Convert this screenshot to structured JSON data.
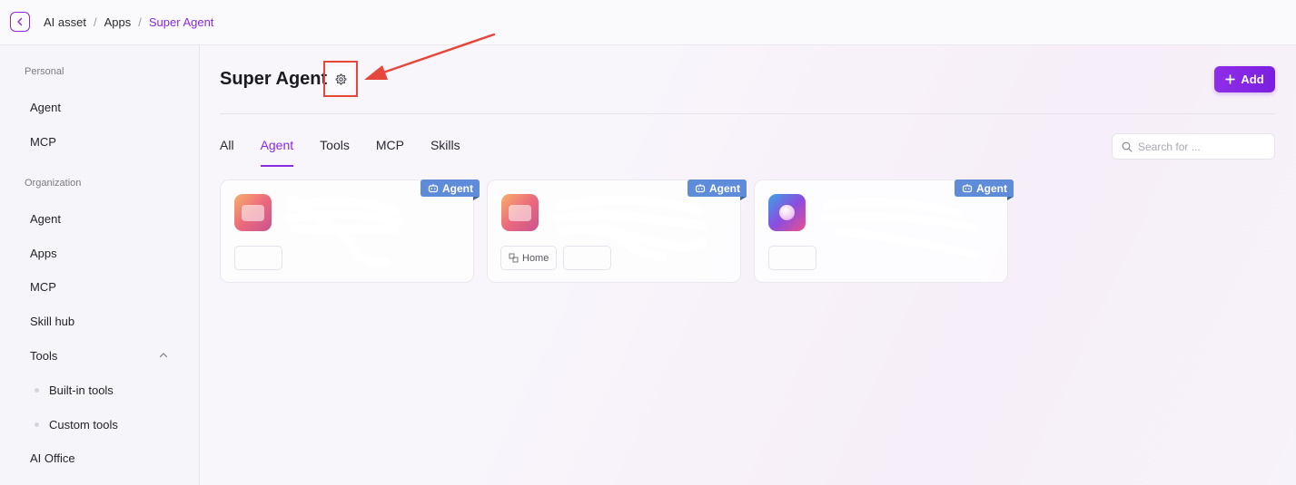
{
  "breadcrumb": [
    "AI asset",
    "Apps",
    "Super Agent"
  ],
  "sidebar": {
    "personal_label": "Personal",
    "personal_items": [
      "Agent",
      "MCP"
    ],
    "org_label": "Organization",
    "org_items": [
      "Agent",
      "Apps",
      "MCP",
      "Skill hub",
      "Tools"
    ],
    "tools_sub": [
      "Built-in tools",
      "Custom tools"
    ],
    "last_item": "AI Office"
  },
  "main": {
    "title": "Super Agent",
    "add_label": "Add",
    "tabs": [
      "All",
      "Agent",
      "Tools",
      "MCP",
      "Skills"
    ],
    "active_tab": "Agent",
    "search_placeholder": "Search for ..."
  },
  "cards": [
    {
      "badge": "Agent",
      "icon": "chat-bubble-app-icon",
      "tags": [
        ""
      ]
    },
    {
      "badge": "Agent",
      "icon": "chat-bubble-app-icon",
      "tags": [
        "Home",
        ""
      ]
    },
    {
      "badge": "Agent",
      "icon": "orb-app-icon",
      "tags": [
        ""
      ]
    }
  ],
  "colors": {
    "accent": "#8a2be2",
    "badge": "#5e8cd9",
    "highlight_box": "#e5473c"
  }
}
